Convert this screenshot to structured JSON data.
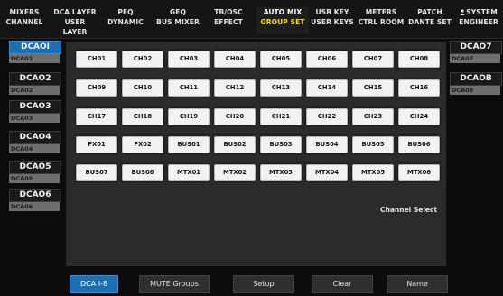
{
  "tabs": [
    {
      "line1": "MIXERS",
      "line2": "CHANNEL",
      "active": false
    },
    {
      "line1": "DCA LAYER",
      "line2": "USER LAYER",
      "active": false
    },
    {
      "line1": "PEQ",
      "line2": "DYNAMIC",
      "active": false
    },
    {
      "line1": "GEQ",
      "line2": "BUS MIXER",
      "active": false
    },
    {
      "line1": "TB/OSC",
      "line2": "EFFECT",
      "active": false
    },
    {
      "line1": "AUTO MIX",
      "line2": "GROUP SET",
      "active": true
    },
    {
      "line1": "USB KEY",
      "line2": "USER KEYS",
      "active": false
    },
    {
      "line1": "METERS",
      "line2": "CTRL ROOM",
      "active": false
    },
    {
      "line1": "PATCH",
      "line2": "DANTE SET",
      "active": false
    },
    {
      "line1": "SYSTEM",
      "line2": "ENGINEER",
      "active": false,
      "icon": "user-icon"
    }
  ],
  "left_dcas": [
    {
      "name": "DCAOI",
      "label": "DCA01",
      "selected": true
    },
    {
      "name": "DCAO2",
      "label": "DCA02",
      "selected": false
    },
    {
      "name": "DCAO3",
      "label": "DCA03",
      "selected": false
    },
    {
      "name": "DCAO4",
      "label": "DCA04",
      "selected": false
    },
    {
      "name": "DCAO5",
      "label": "DCA05",
      "selected": false
    },
    {
      "name": "DCAO6",
      "label": "DCA06",
      "selected": false
    }
  ],
  "right_dcas": [
    {
      "name": "DCAO7",
      "label": "DCA07",
      "selected": false
    },
    {
      "name": "DCAOB",
      "label": "DCA08",
      "selected": false
    }
  ],
  "channels": [
    [
      "CH01",
      "CH02",
      "CH03",
      "CH04",
      "CH05",
      "CH06",
      "CH07",
      "CH08"
    ],
    [
      "CH09",
      "CH10",
      "CH11",
      "CH12",
      "CH13",
      "CH14",
      "CH15",
      "CH16"
    ],
    [
      "CH17",
      "CH18",
      "CH19",
      "CH20",
      "CH21",
      "CH22",
      "CH23",
      "CH24"
    ],
    [
      "FX01",
      "FX02",
      "BUS01",
      "BUS02",
      "BUS03",
      "BUS04",
      "BUS05",
      "BUS06"
    ],
    [
      "BUS07",
      "BUS08",
      "MTX01",
      "MTX02",
      "MTX03",
      "MTX04",
      "MTX05",
      "MTX06"
    ]
  ],
  "channel_select_label": "Channel Select",
  "bottom_buttons": [
    {
      "label": "DCA I-8",
      "selected": true
    },
    {
      "label": "MUTE Groups",
      "selected": false
    },
    {
      "label": "Setup",
      "selected": false
    },
    {
      "label": "Clear",
      "selected": false
    },
    {
      "label": "Name",
      "selected": false
    }
  ],
  "colors": {
    "accent": "#1d6fb4",
    "active_tab_text": "#f0e000"
  }
}
